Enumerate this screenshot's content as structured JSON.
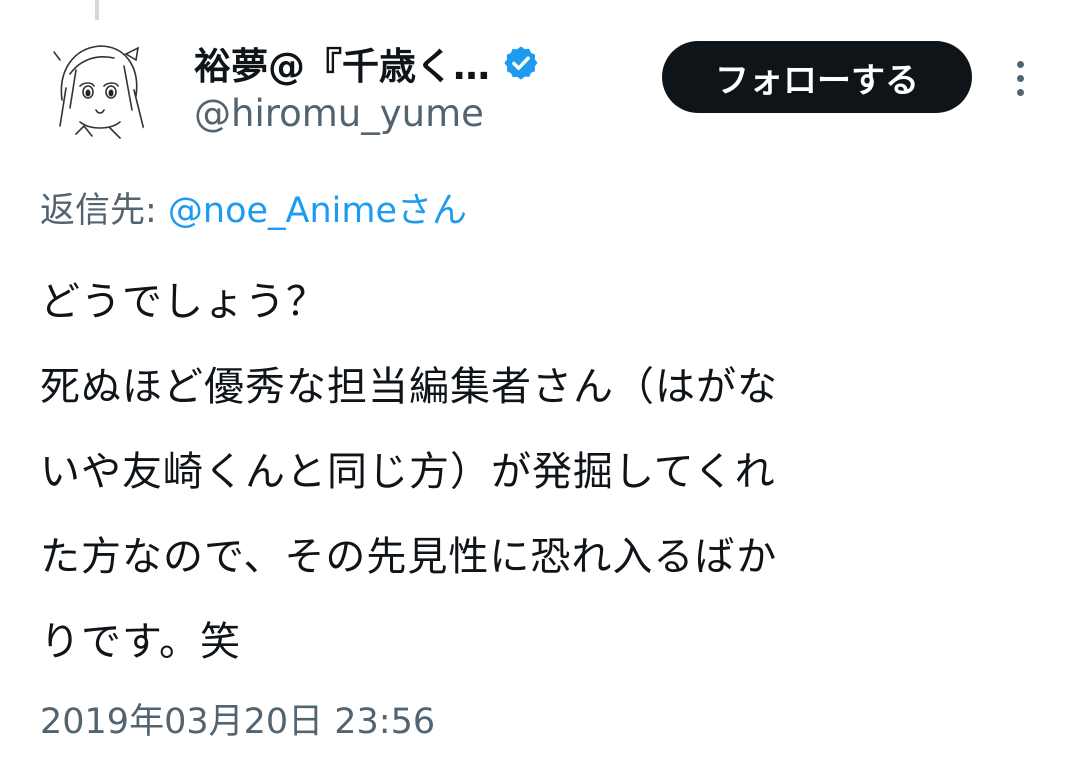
{
  "author": {
    "display_name": "裕夢@『千歳く…",
    "handle": "@hiromu_yume",
    "verified_icon": "verified-badge-icon",
    "avatar_icon": "anime-girl-sketch-avatar"
  },
  "follow_button": {
    "label": "フォローする"
  },
  "more_icon": "vertical-ellipsis-icon",
  "reply": {
    "prefix": "返信先: ",
    "mention": "@noe_Animeさん"
  },
  "tweet": {
    "lines": [
      "どうでしょう？",
      "死ぬほど優秀な担当編集者さん（はがな",
      "いや友崎くんと同じ方）が発掘してくれ",
      "た方なので、その先見性に恐れ入るばか",
      "りです。笑"
    ]
  },
  "timestamp": "2019年03月20日 23:56",
  "colors": {
    "text": "#0f1419",
    "secondary": "#536471",
    "link": "#1d9bf0",
    "button_bg": "#0f1419",
    "button_text": "#ffffff"
  }
}
